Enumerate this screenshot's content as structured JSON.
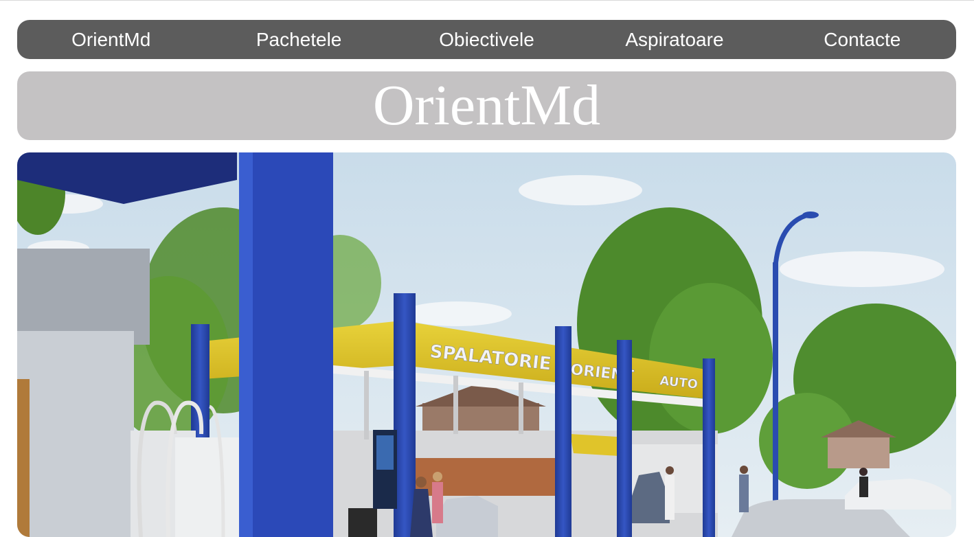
{
  "nav": {
    "items": [
      {
        "label": "OrientMd"
      },
      {
        "label": "Pachetele"
      },
      {
        "label": "Obiectivele"
      },
      {
        "label": "Aspiratoare"
      },
      {
        "label": "Contacte"
      }
    ]
  },
  "banner": {
    "title": "OrientMd"
  },
  "hero": {
    "sign_word_1": "SPALATORIE",
    "sign_word_2": "ORIENT",
    "sign_word_3": "AUTO"
  },
  "colors": {
    "nav_bg": "#5c5c5c",
    "banner_bg": "#c4c2c3",
    "canopy_yellow": "#e2c92a",
    "pillar_blue": "#2a4cb0",
    "sky": "#d7e6f2"
  }
}
